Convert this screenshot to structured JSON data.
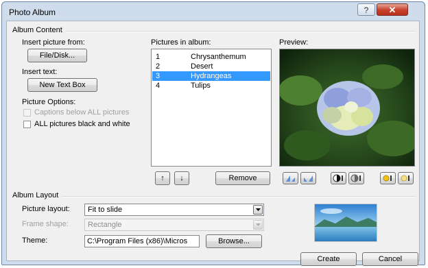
{
  "window": {
    "title": "Photo Album",
    "help_glyph": "?",
    "close_glyph": "✕"
  },
  "album_content": {
    "group_label": "Album Content",
    "insert_picture_label": "Insert picture from:",
    "file_disk_button": "File/Disk...",
    "insert_text_label": "Insert text:",
    "new_text_box_button": "New Text Box",
    "picture_options_label": "Picture Options:",
    "captions_checkbox": {
      "label": "Captions below ALL pictures",
      "checked": false,
      "enabled": false
    },
    "black_white_checkbox": {
      "label": "ALL pictures black and white",
      "checked": false,
      "enabled": true
    },
    "pictures_label": "Pictures in album:",
    "pictures": [
      {
        "num": "1",
        "name": "Chrysanthemum",
        "selected": false
      },
      {
        "num": "2",
        "name": "Desert",
        "selected": false
      },
      {
        "num": "3",
        "name": "Hydrangeas",
        "selected": true
      },
      {
        "num": "4",
        "name": "Tulips",
        "selected": false
      }
    ],
    "move_up_glyph": "↑",
    "move_down_glyph": "↓",
    "remove_button": "Remove",
    "preview_label": "Preview:"
  },
  "album_layout": {
    "group_label": "Album Layout",
    "picture_layout_label": "Picture layout:",
    "picture_layout_value": "Fit to slide",
    "frame_shape_label": "Frame shape:",
    "frame_shape_value": "Rectangle",
    "theme_label": "Theme:",
    "theme_value": "C:\\Program Files (x86)\\Micros",
    "browse_button": "Browse..."
  },
  "footer": {
    "create_button": "Create",
    "cancel_button": "Cancel"
  },
  "colors": {
    "selection": "#3399ff",
    "frame": "#cfdcec",
    "close": "#c5412c"
  },
  "icons": [
    "help-icon",
    "close-icon",
    "move-up-icon",
    "move-down-icon",
    "rotate-left-icon",
    "rotate-right-icon",
    "contrast-up-icon",
    "contrast-down-icon",
    "brightness-up-icon",
    "brightness-down-icon",
    "chevron-down-icon"
  ]
}
